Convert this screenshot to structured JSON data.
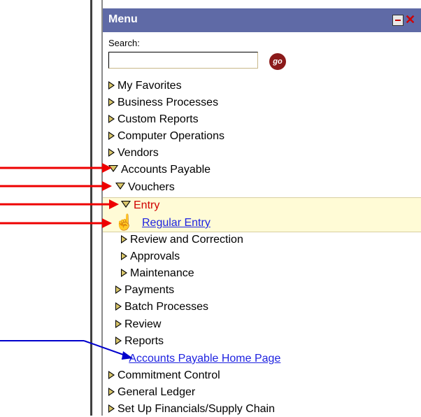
{
  "menu": {
    "title": "Menu",
    "search_label": "Search:",
    "search_value": "",
    "go_label": "go"
  },
  "items": [
    {
      "label": "My Favorites"
    },
    {
      "label": "Business Processes"
    },
    {
      "label": "Custom Reports"
    },
    {
      "label": "Computer Operations"
    },
    {
      "label": "Vendors"
    },
    {
      "label": "Accounts Payable"
    },
    {
      "label": "Vouchers"
    },
    {
      "label": "Entry"
    },
    {
      "label": "Regular Entry"
    },
    {
      "label": "Review and Correction"
    },
    {
      "label": "Approvals"
    },
    {
      "label": "Maintenance"
    },
    {
      "label": "Payments"
    },
    {
      "label": "Batch Processes"
    },
    {
      "label": "Review"
    },
    {
      "label": "Reports"
    },
    {
      "label": "Accounts Payable Home Page"
    },
    {
      "label": "Commitment Control"
    },
    {
      "label": "General Ledger"
    },
    {
      "label": "Set Up Financials/Supply Chain"
    }
  ],
  "colors": {
    "titlebar": "#5f6aa6",
    "highlight": "#fffbd6",
    "red_arrow": "#ee0000",
    "blue_arrow": "#0000cc",
    "link": "#1e22e0",
    "active": "#d00000"
  }
}
